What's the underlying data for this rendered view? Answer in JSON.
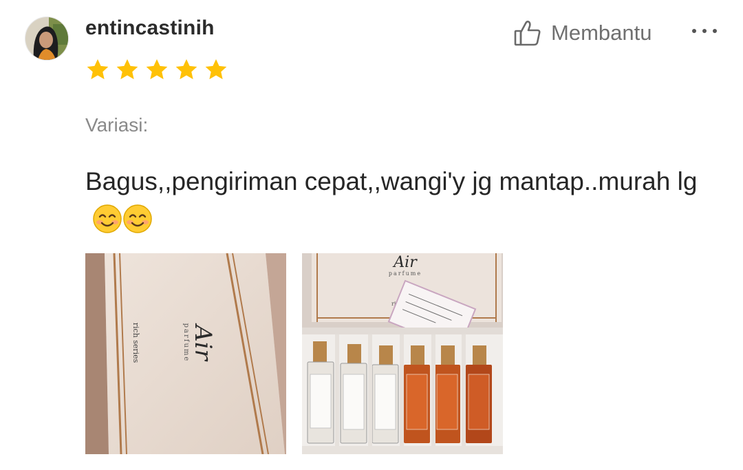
{
  "review": {
    "username": "entincastinih",
    "rating": 5,
    "rating_max": 5,
    "helpful_label": "Membantu",
    "variation_label": "Variasi:",
    "text": "Bagus,,pengiriman cepat,,wangi'y jg mantap..murah lg",
    "emojis": [
      "smiling-face-icon",
      "smiling-face-icon"
    ]
  },
  "photos": [
    {
      "brand": "Air",
      "line": "parfume",
      "series": "rich series"
    },
    {
      "brand": "Air",
      "line": "parfume",
      "lid_text": "rich"
    }
  ],
  "colors": {
    "star": "#ffc107",
    "helpful": "#707070",
    "muted": "#8a8a8a"
  },
  "icons": [
    "thumbs-up-icon",
    "more-icon",
    "star-icon",
    "smiling-face-icon"
  ]
}
